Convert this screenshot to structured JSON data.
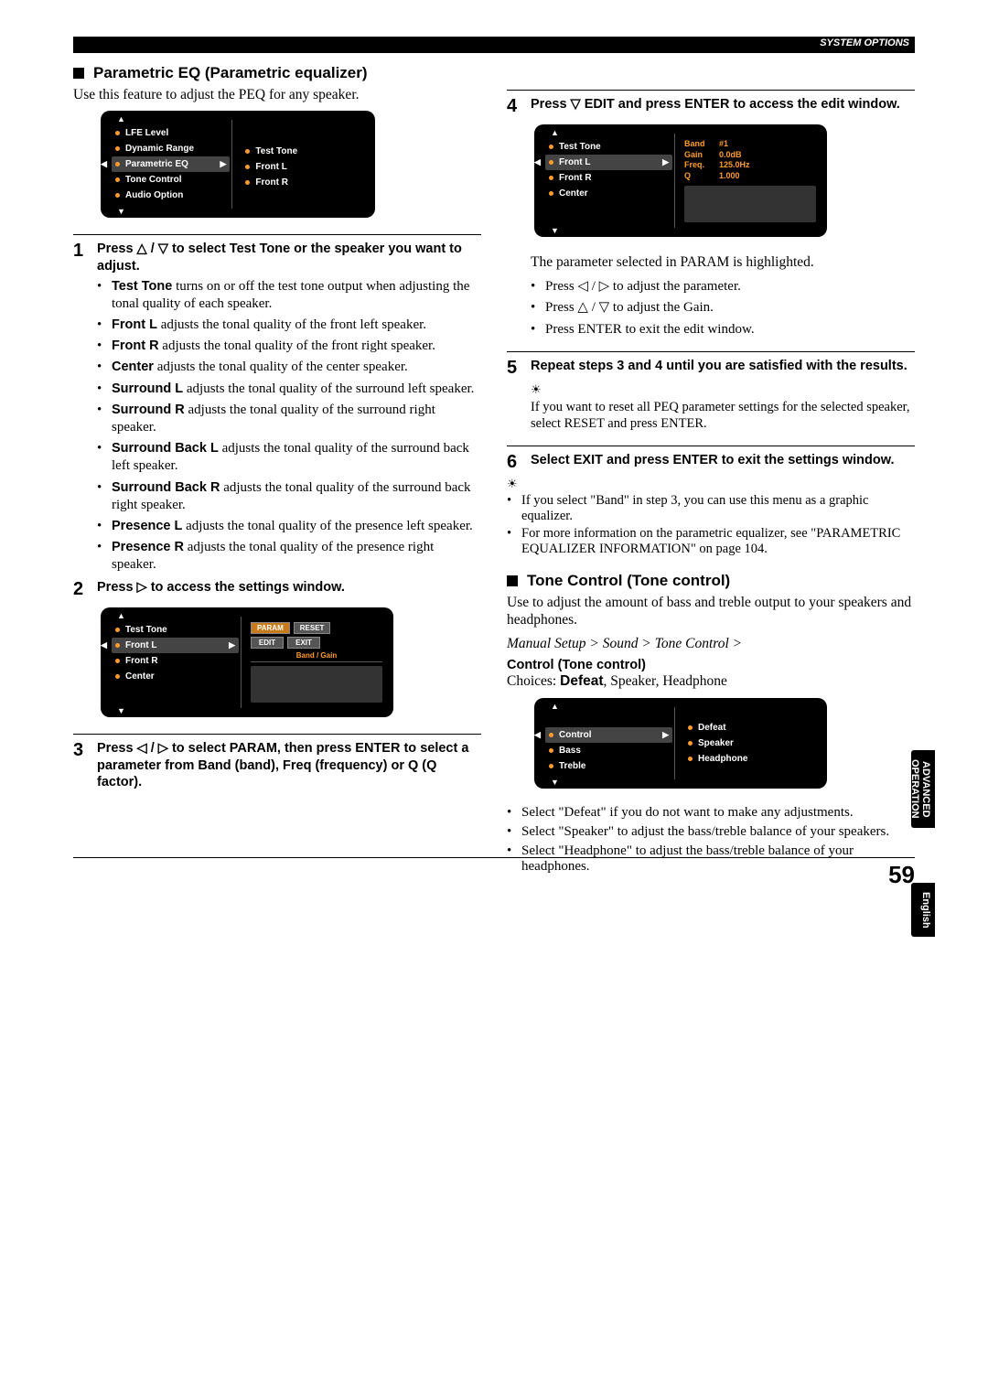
{
  "header": {
    "system_options": "SYSTEM OPTIONS"
  },
  "peq": {
    "title": "Parametric EQ (Parametric equalizer)",
    "intro": "Use this feature to adjust the PEQ for any speaker.",
    "menu1": {
      "left": [
        "LFE Level",
        "Dynamic Range",
        "Parametric EQ",
        "Tone Control",
        "Audio Option"
      ],
      "sel_left_idx": 2,
      "right": [
        "Test Tone",
        "Front L",
        "Front R"
      ]
    },
    "step1": {
      "head": "Press △ / ▽ to select Test Tone or the speaker you want to adjust.",
      "bullets": [
        {
          "b": "Test Tone",
          "rest": " turns on or off the test tone output when adjusting the tonal quality of each speaker."
        },
        {
          "b": "Front L",
          "rest": " adjusts the tonal quality of the front left speaker."
        },
        {
          "b": "Front R",
          "rest": " adjusts the tonal quality of the front right speaker."
        },
        {
          "b": "Center",
          "rest": " adjusts the tonal quality of the center speaker."
        },
        {
          "b": "Surround L",
          "rest": " adjusts the tonal quality of the surround left speaker."
        },
        {
          "b": "Surround R",
          "rest": " adjusts the tonal quality of the surround right speaker."
        },
        {
          "b": "Surround Back L",
          "rest": " adjusts the tonal quality of the surround back left speaker."
        },
        {
          "b": "Surround Back R",
          "rest": " adjusts the tonal quality of the surround back right speaker."
        },
        {
          "b": "Presence L",
          "rest": " adjusts the tonal quality of the presence left speaker."
        },
        {
          "b": "Presence R",
          "rest": " adjusts the tonal quality of the presence right speaker."
        }
      ]
    },
    "step2": {
      "head": "Press ▷ to access the settings window.",
      "menu": {
        "left": [
          "Test Tone",
          "Front L",
          "Front R",
          "Center"
        ],
        "sel_left_idx": 1,
        "params": [
          "PARAM",
          "RESET",
          "EDIT",
          "EXIT"
        ],
        "bandgain": "Band / Gain"
      }
    },
    "step3": {
      "head": "Press ◁ / ▷ to select PARAM, then press ENTER to select a parameter from Band (band), Freq (frequency) or Q (Q factor)."
    }
  },
  "right": {
    "step4": {
      "head": "Press ▽ EDIT and press ENTER to access the edit window.",
      "menu": {
        "left": [
          "Test Tone",
          "Front L",
          "Front R",
          "Center"
        ],
        "sel_left_idx": 1,
        "kv": [
          {
            "k": "Band",
            "v": "#1"
          },
          {
            "k": "Gain",
            "v": "0.0dB"
          },
          {
            "k": "Freq.",
            "v": "125.0Hz"
          },
          {
            "k": "Q",
            "v": "1.000"
          }
        ]
      },
      "after": "The parameter selected in PARAM is highlighted.",
      "bullets": [
        "Press ◁ / ▷ to adjust the parameter.",
        "Press △ / ▽ to adjust the Gain.",
        "Press ENTER to exit the edit window."
      ]
    },
    "step5": {
      "head": "Repeat steps 3 and 4 until you are satisfied with the results.",
      "hint": "If you want to reset all PEQ parameter settings for the selected speaker, select RESET and press ENTER."
    },
    "step6": {
      "head": "Select EXIT and press ENTER to exit the settings window.",
      "notes": [
        "If you select \"Band\" in step 3, you can use this menu as a graphic equalizer.",
        "For more information on the parametric equalizer, see \"PARAMETRIC EQUALIZER INFORMATION\" on page 104."
      ]
    },
    "tone": {
      "title": "Tone Control (Tone control)",
      "intro": "Use to adjust the amount of bass and treble output to your speakers and headphones.",
      "path": "Manual Setup > Sound > Tone Control >",
      "sub": "Control (Tone control)",
      "choices_pre": "Choices: ",
      "choices_bold": "Defeat",
      "choices_rest": ", Speaker, Headphone",
      "menu": {
        "left": [
          "Control",
          "Bass",
          "Treble"
        ],
        "sel_left_idx": 0,
        "right": [
          "Defeat",
          "Speaker",
          "Headphone"
        ]
      },
      "bullets": [
        "Select \"Defeat\" if you do not want to make any adjustments.",
        "Select \"Speaker\" to adjust the bass/treble balance of your speakers.",
        "Select \"Headphone\" to adjust the bass/treble balance of your headphones."
      ]
    }
  },
  "tabs": {
    "adv1": "ADVANCED",
    "adv2": "OPERATION",
    "eng": "English"
  },
  "page": "59"
}
